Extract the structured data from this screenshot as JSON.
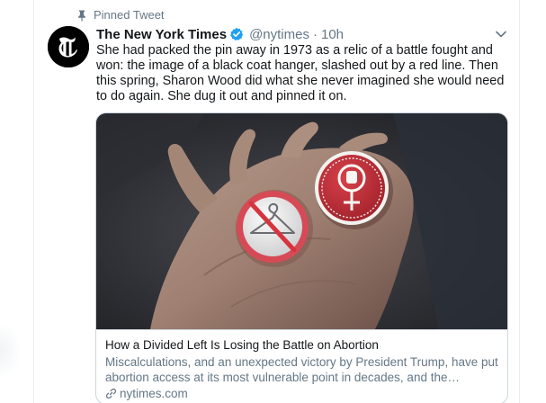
{
  "pinned": {
    "label": "Pinned Tweet",
    "icon": "pin-icon"
  },
  "tweet": {
    "author": {
      "name": "The New York Times",
      "handle": "@nytimes",
      "verified": true,
      "avatar_icon": "nyt-logo-icon"
    },
    "separator": "·",
    "time": "10h",
    "text": "She had packed the pin away in 1973 as a relic of a battle fought and won: the image of a black coat hanger, slashed out by a red line. Then this spring, Sharon Wood did what she never imagined she would need to do again. She dug it out and pinned it on.",
    "menu_icon": "chevron-down-icon"
  },
  "card": {
    "image_icon": "hand-holding-pins-photo",
    "title": "How a Divided Left Is Losing the Battle on Abortion",
    "description": "Miscalculations, and an unexpected victory by President Trump, have put abortion access at its most vulnerable point in decades, and the…",
    "domain": "nytimes.com",
    "link_icon": "link-icon"
  },
  "colors": {
    "text_primary": "#14171a",
    "text_secondary": "#657786",
    "verified_blue": "#1da1f2",
    "border": "#ccd6dd"
  }
}
